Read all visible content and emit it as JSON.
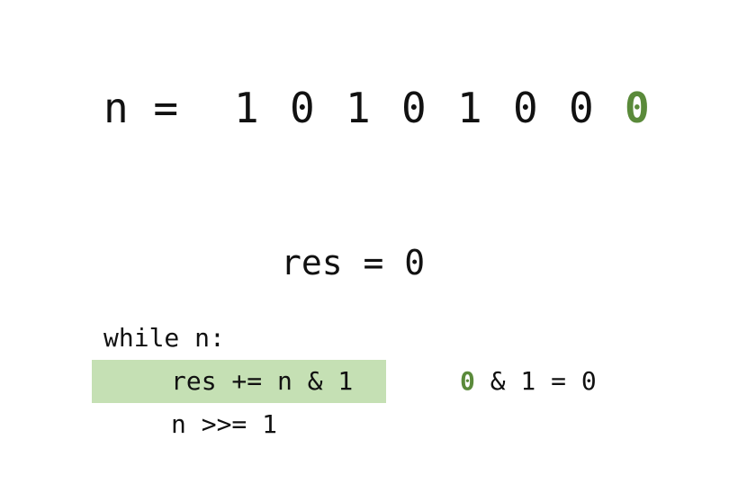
{
  "bits": {
    "label": "n =",
    "values": [
      "1",
      "0",
      "1",
      "0",
      "1",
      "0",
      "0",
      "0"
    ],
    "highlight_index": 7,
    "highlight_color": "#5a8a3a"
  },
  "res": {
    "text": "res = 0"
  },
  "code": {
    "lines": [
      "while n:",
      "res += n & 1",
      "n >>= 1"
    ],
    "active_line_index": 1,
    "active_line_bg": "#c5e0b4"
  },
  "evaluation": {
    "bit": "0",
    "rest": " & 1 = 0"
  }
}
